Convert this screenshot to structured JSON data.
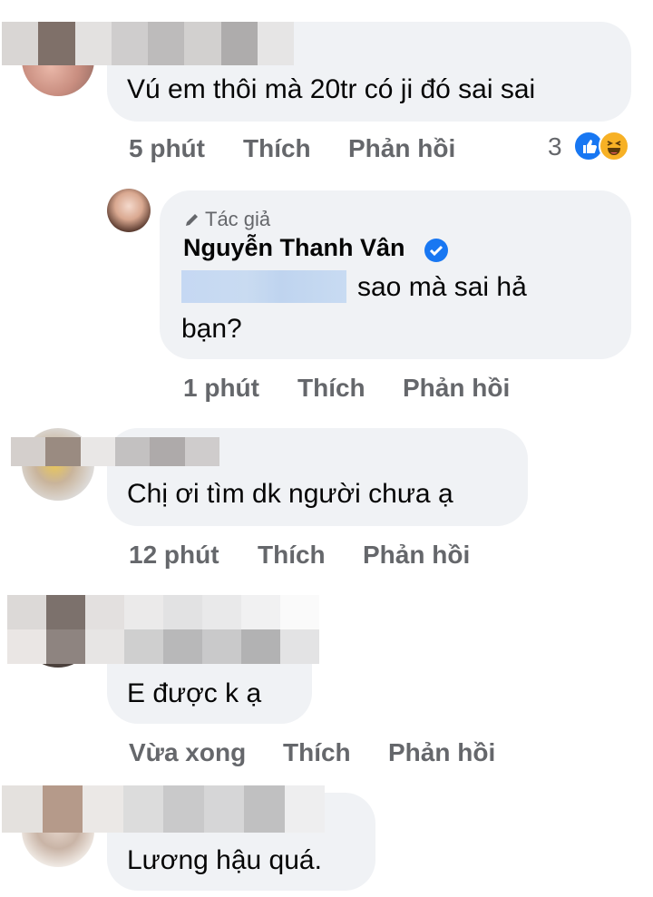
{
  "comments": [
    {
      "text": "Vú em thôi mà 20tr có ji đó sai sai",
      "time": "5 phút",
      "like_label": "Thích",
      "reply_label": "Phản hồi",
      "reaction_count": "3",
      "reactions": [
        "like-icon",
        "haha-icon"
      ]
    },
    {
      "badge": "Tác giả",
      "author": "Nguyễn Thanh Vân",
      "text_line1": "sao mà sai hả",
      "text_line2": "bạn?",
      "time": "1 phút",
      "like_label": "Thích",
      "reply_label": "Phản hồi"
    },
    {
      "text": "Chị ơi tìm dk người chưa ạ",
      "time": "12 phút",
      "like_label": "Thích",
      "reply_label": "Phản hồi"
    },
    {
      "text": "E được k ạ",
      "time": "Vừa xong",
      "like_label": "Thích",
      "reply_label": "Phản hồi"
    },
    {
      "text": "Lương hậu quá."
    }
  ],
  "colors": {
    "bubble": "#f0f2f5",
    "action_text": "#65676b",
    "like_blue": "#1877f2",
    "haha_yellow": "#f7b125"
  }
}
